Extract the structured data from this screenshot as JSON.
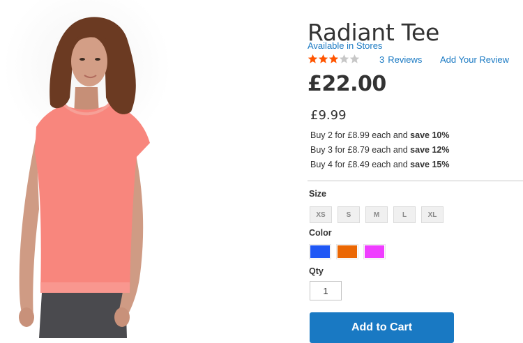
{
  "product": {
    "name": "Radiant Tee",
    "availability": "Available in Stores",
    "rating": {
      "stars_filled": 3,
      "stars_total": 5,
      "count": "3",
      "reviews_label": "Reviews"
    },
    "add_review_label": "Add Your Review",
    "price": "£22.00",
    "image_icon": "product-photo-pink-tee"
  },
  "tier_pricing": {
    "price": "£9.99",
    "lines": [
      {
        "text": "Buy 2 for £8.99 each and",
        "save": "save 10%"
      },
      {
        "text": "Buy 3 for £8.79 each and",
        "save": "save 12%"
      },
      {
        "text": "Buy 4 for £8.49 each and",
        "save": "save 15%"
      }
    ]
  },
  "options": {
    "size_label": "Size",
    "sizes": [
      "XS",
      "S",
      "M",
      "L",
      "XL"
    ],
    "color_label": "Color",
    "colors": [
      {
        "name": "Blue",
        "hex": "#1f57f5"
      },
      {
        "name": "Orange",
        "hex": "#eb6703"
      },
      {
        "name": "Purple",
        "hex": "#ef3dff"
      }
    ]
  },
  "qty": {
    "label": "Qty",
    "value": "1"
  },
  "cart": {
    "button_label": "Add to Cart"
  },
  "theme": {
    "star_filled": "#ff5501",
    "star_empty": "#c7c7c7",
    "link": "#1979c3",
    "button": "#1979c3",
    "shirt": "#f8867d"
  }
}
